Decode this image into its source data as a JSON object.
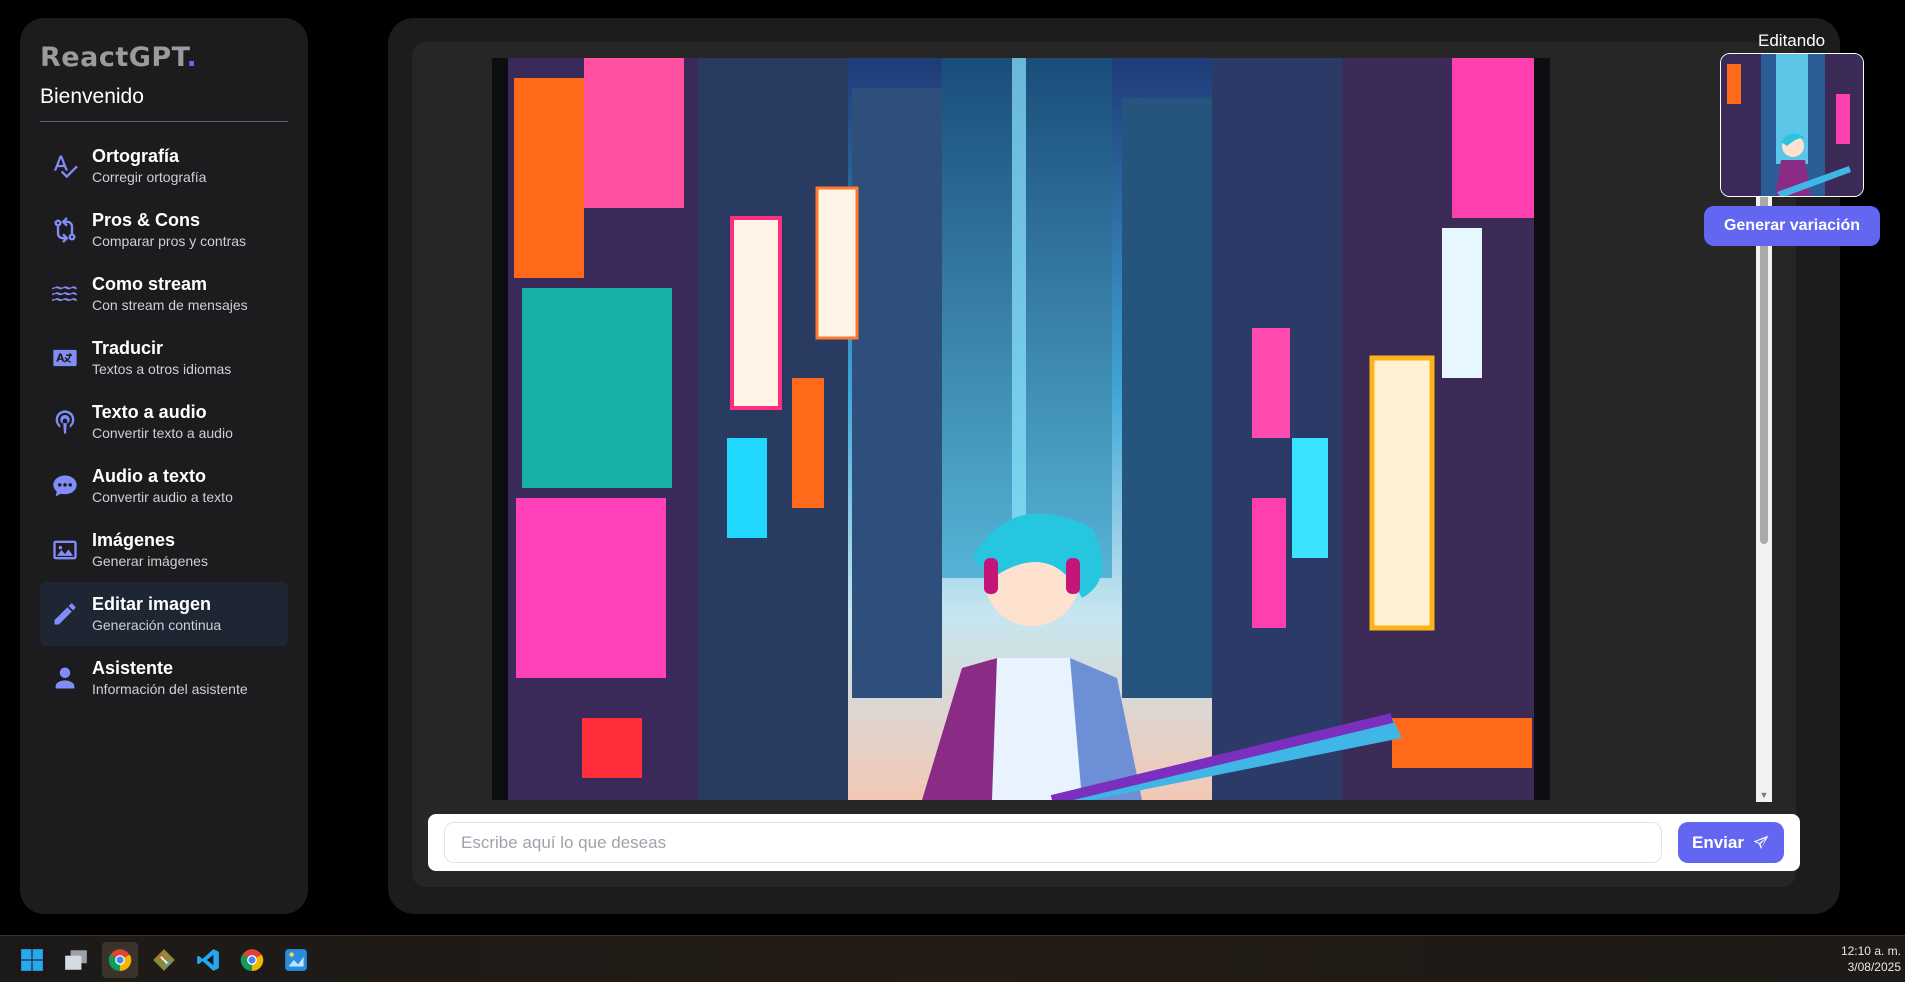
{
  "sidebar": {
    "logo": "ReactGPT",
    "logo_dot": ".",
    "welcome": "Bienvenido",
    "items": [
      {
        "title": "Ortografía",
        "subtitle": "Corregir ortografía",
        "icon": "spellcheck-icon"
      },
      {
        "title": "Pros & Cons",
        "subtitle": "Comparar pros y contras",
        "icon": "compare-arrows-icon"
      },
      {
        "title": "Como stream",
        "subtitle": "Con stream de mensajes",
        "icon": "water-waves-icon"
      },
      {
        "title": "Traducir",
        "subtitle": "Textos a otros idiomas",
        "icon": "language-translate-icon"
      },
      {
        "title": "Texto a audio",
        "subtitle": "Convertir texto a audio",
        "icon": "podcast-icon"
      },
      {
        "title": "Audio a texto",
        "subtitle": "Convertir audio a texto",
        "icon": "comment-dots-icon"
      },
      {
        "title": "Imágenes",
        "subtitle": "Generar imágenes",
        "icon": "image-icon"
      },
      {
        "title": "Editar imagen",
        "subtitle": "Generación continua",
        "icon": "pencil-icon",
        "active": true
      },
      {
        "title": "Asistente",
        "subtitle": "Información del asistente",
        "icon": "user-icon"
      }
    ]
  },
  "main": {
    "input_placeholder": "Escribe aquí lo que deseas",
    "input_value": "",
    "send_label": "Enviar"
  },
  "editing": {
    "label": "Editando",
    "variation_button": "Generar variación"
  },
  "taskbar": {
    "apps": [
      "windows-start-icon",
      "task-view-icon",
      "chrome-icon",
      "git-icon",
      "vscode-icon",
      "chrome-icon",
      "paint-icon"
    ],
    "time": "12:10 a. m.",
    "date": "3/08/2025"
  },
  "colors": {
    "accent": "#6366f1",
    "icon": "#818cf8",
    "sidebar_bg": "#1c1c1e",
    "active_bg": "#1f2633"
  }
}
